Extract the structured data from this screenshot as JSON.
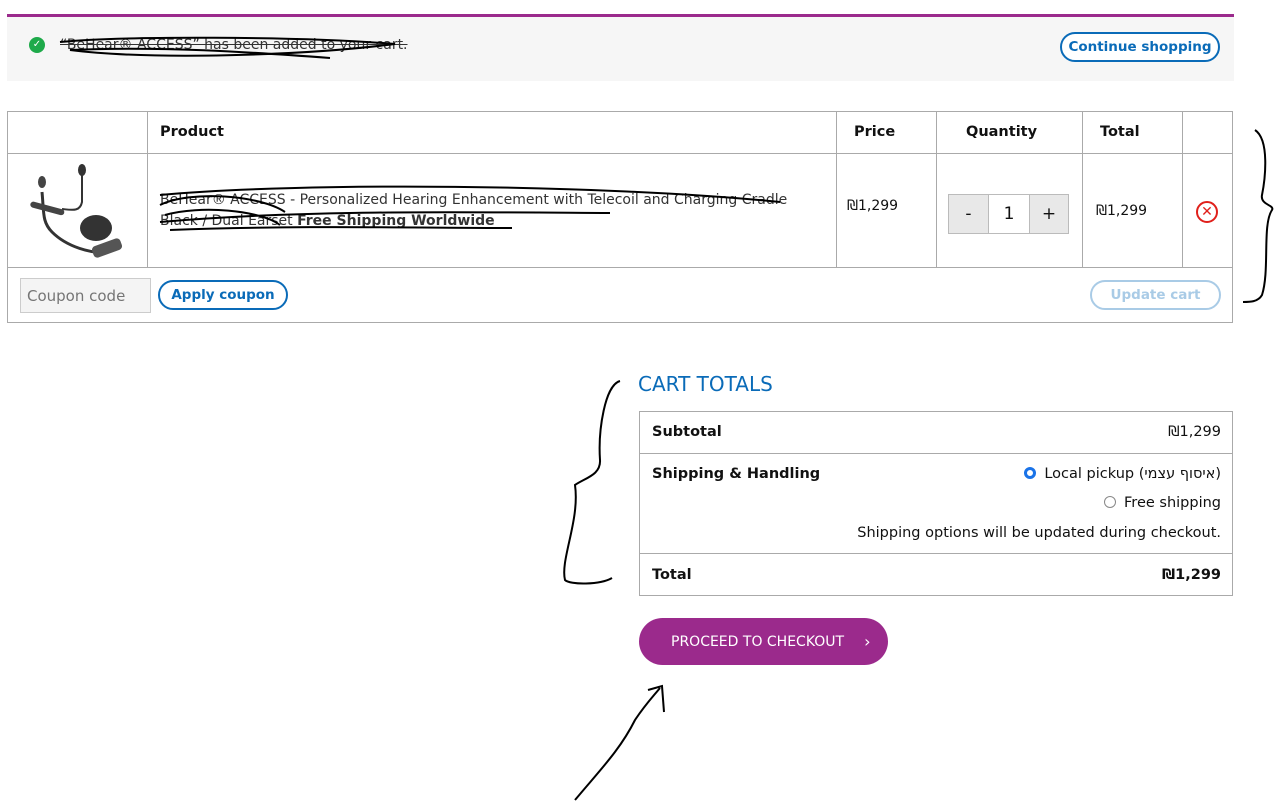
{
  "notice": {
    "icon": "check-circle-icon",
    "message": "“BeHear® ACCESS” has been added to your cart.",
    "continue_label": "Continue shopping"
  },
  "cart": {
    "headers": {
      "product": "Product",
      "price": "Price",
      "quantity": "Quantity",
      "total": "Total"
    },
    "items": [
      {
        "name": "BeHear® ACCESS - Personalized Hearing Enhancement with Telecoil and Charging Cradle",
        "variant": "Black / Dual Earset",
        "shipping_note": "Free Shipping Worldwide",
        "price": "₪1,299",
        "quantity": "1",
        "total": "₪1,299"
      }
    ],
    "coupon_placeholder": "Coupon code",
    "apply_label": "Apply coupon",
    "update_label": "Update cart"
  },
  "totals": {
    "heading": "CART TOTALS",
    "subtotal_label": "Subtotal",
    "subtotal": "₪1,299",
    "shipping_label": "Shipping & Handling",
    "options": [
      {
        "label": "Local pickup (איסוף עצמי)",
        "selected": true
      },
      {
        "label": "Free shipping",
        "selected": false
      }
    ],
    "shipping_note": "Shipping options will be updated during checkout.",
    "total_label": "Total",
    "total": "₪1,299",
    "checkout_label": "PROCEED TO CHECKOUT"
  },
  "colors": {
    "accent": "#9b2a8c",
    "link": "#0a6bb8",
    "success": "#1eaa4a",
    "remove": "#e0201b"
  }
}
